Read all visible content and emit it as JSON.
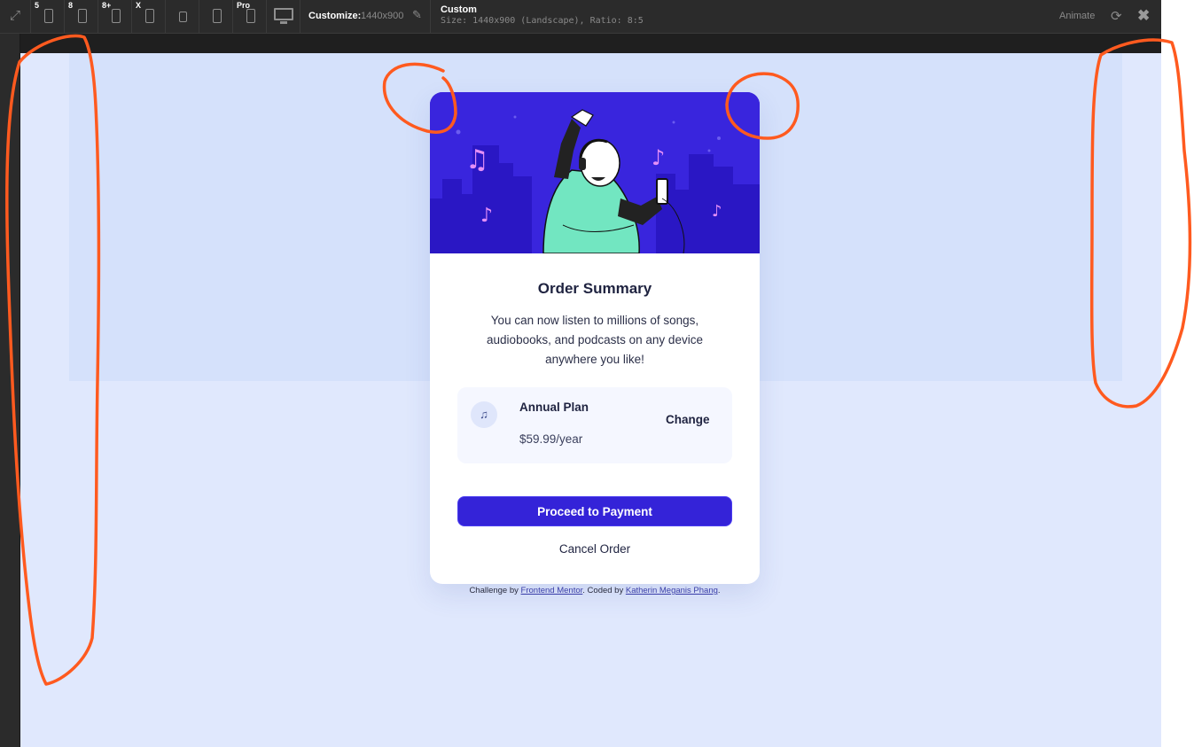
{
  "toolbar": {
    "devices": [
      {
        "tag": "5"
      },
      {
        "tag": "8"
      },
      {
        "tag": "8+"
      },
      {
        "tag": "X"
      },
      {
        "tag": ""
      },
      {
        "tag": ""
      },
      {
        "tag": "Pro"
      },
      {
        "tag": ""
      }
    ],
    "customize_label": "Customize:",
    "customize_value": "1440x900",
    "info_title": "Custom",
    "info_subtitle": "Size: 1440x900 (Landscape), Ratio: 8:5",
    "animate_label": "Animate"
  },
  "card": {
    "title": "Order Summary",
    "description": "You can now listen to millions of songs, audiobooks, and podcasts on any device anywhere you like!",
    "plan_name": "Annual Plan",
    "plan_price": "$59.99/year",
    "change_label": "Change",
    "pay_button": "Proceed to Payment",
    "cancel_label": "Cancel Order"
  },
  "credit": {
    "prefix": "Challenge by ",
    "link1": "Frontend Mentor",
    "middle": ". Coded by ",
    "link2": "Katherin Meganis Phang",
    "suffix": "."
  },
  "colors": {
    "accent": "#3423d8",
    "hero_bg": "#3925dd",
    "page_bg": "#e0e8fd",
    "annotation": "#ff5a1f"
  },
  "icons": [
    "expand-icon",
    "phone-icon",
    "tablet-icon",
    "desktop-icon",
    "pencil-icon",
    "rotate-icon",
    "close-icon",
    "music-note-icon"
  ]
}
